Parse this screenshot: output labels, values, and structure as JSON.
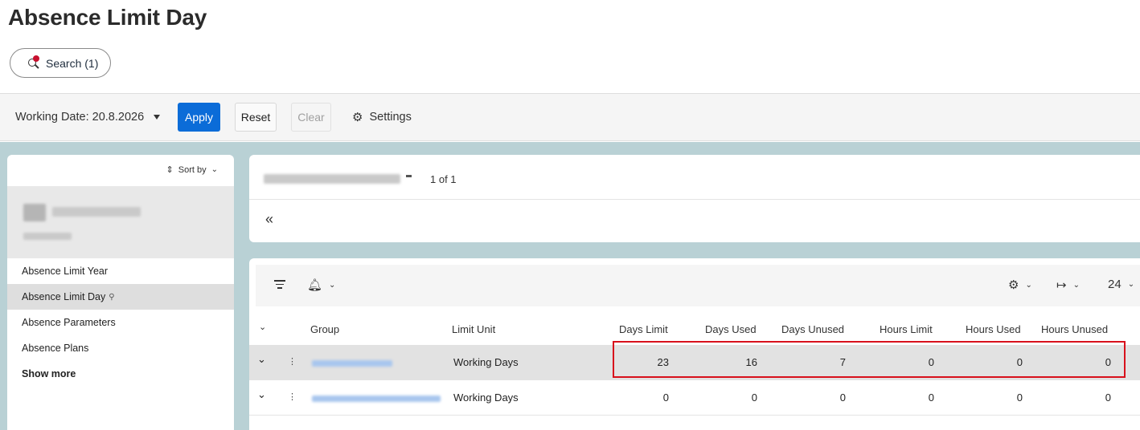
{
  "page": {
    "title": "Absence Limit Day"
  },
  "search": {
    "label": "Search (1)"
  },
  "toolbar": {
    "working_date": "Working Date: 20.8.2026",
    "apply": "Apply",
    "reset": "Reset",
    "clear": "Clear",
    "settings": "Settings"
  },
  "left_panel": {
    "sort_by": "Sort by",
    "menu": [
      {
        "label": "Absence Limit Year"
      },
      {
        "label": "Absence Limit Day",
        "active": true
      },
      {
        "label": "Absence Parameters"
      },
      {
        "label": "Absence Plans"
      },
      {
        "label": "Show more"
      }
    ]
  },
  "record": {
    "pager": "1 of 1"
  },
  "grid": {
    "page_size": "24",
    "columns": {
      "group": "Group",
      "limit_unit": "Limit Unit",
      "days_limit": "Days Limit",
      "days_used": "Days Used",
      "days_unused": "Days Unused",
      "hours_limit": "Hours Limit",
      "hours_used": "Hours Used",
      "hours_unused": "Hours Unused"
    },
    "rows": [
      {
        "limit_unit": "Working Days",
        "days_limit": "23",
        "days_used": "16",
        "days_unused": "7",
        "hours_limit": "0",
        "hours_used": "0",
        "hours_unused": "0"
      },
      {
        "limit_unit": "Working Days",
        "days_limit": "0",
        "days_used": "0",
        "days_unused": "0",
        "hours_limit": "0",
        "hours_used": "0",
        "hours_unused": "0"
      }
    ]
  },
  "colors": {
    "accent": "#0b6cd8",
    "workarea": "#b9d1d5",
    "highlight": "#d8111c",
    "notification": "#c8102e"
  },
  "icons": [
    "search-icon",
    "dropdown-caret-icon",
    "gear-icon",
    "sort-icon",
    "chevron-down-icon",
    "pin-icon",
    "double-chevron-left-icon",
    "filter-icon",
    "bell-icon",
    "export-icon",
    "more-vertical-icon"
  ]
}
